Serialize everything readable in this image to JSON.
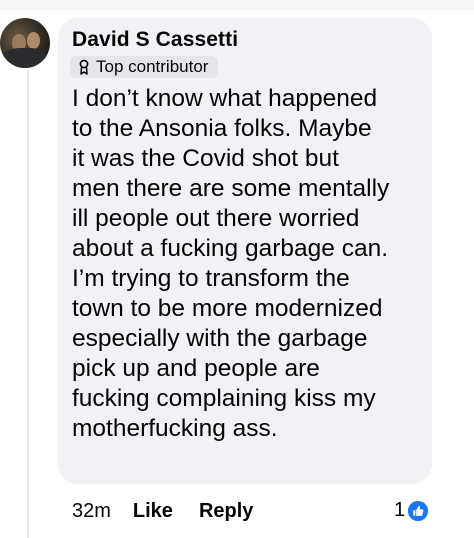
{
  "comment": {
    "author": "David S Cassetti",
    "badge": "Top contributor",
    "badge_icon": "top-contributor-badge-icon",
    "lines": [
      "I don’t know what happened",
      "to the Ansonia folks. Maybe",
      "it was the Covid shot but",
      "men there are some mentally",
      "ill people out there worried",
      "about a fucking garbage can.",
      "I’m trying to transform the",
      "town to be more modernized",
      "especially with the garbage",
      "pick up and people are",
      "fucking complaining kiss my",
      "motherfucking ass."
    ]
  },
  "actions": {
    "timestamp": "32m",
    "like": "Like",
    "reply": "Reply"
  },
  "reactions": {
    "count": "1",
    "icon": "thumbs-up-icon"
  },
  "colors": {
    "bubble": "#f0f2f5",
    "badge": "#e4e6eb",
    "like_blue": "#1877f2",
    "text": "#050505"
  }
}
